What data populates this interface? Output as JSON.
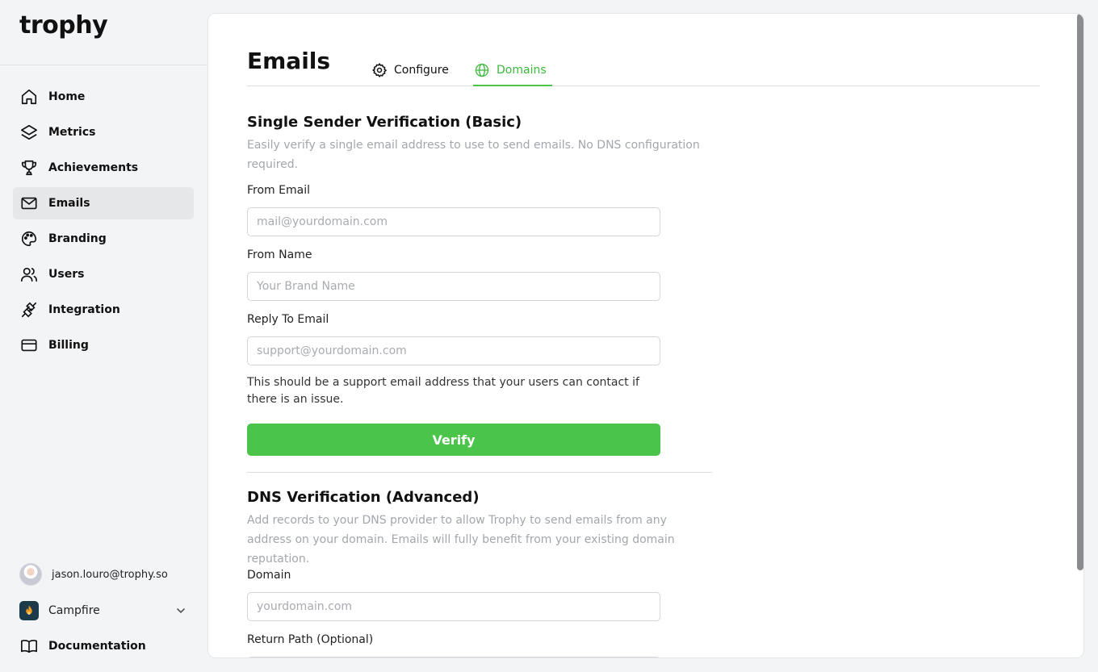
{
  "sidebar": {
    "logo": "trophy",
    "items": [
      {
        "label": "Home",
        "icon": "home-icon",
        "active": false
      },
      {
        "label": "Metrics",
        "icon": "layers-icon",
        "active": false
      },
      {
        "label": "Achievements",
        "icon": "trophy-icon",
        "active": false
      },
      {
        "label": "Emails",
        "icon": "mail-icon",
        "active": true
      },
      {
        "label": "Branding",
        "icon": "palette-icon",
        "active": false
      },
      {
        "label": "Users",
        "icon": "users-icon",
        "active": false
      },
      {
        "label": "Integration",
        "icon": "plug-icon",
        "active": false
      },
      {
        "label": "Billing",
        "icon": "credit-card-icon",
        "active": false
      }
    ],
    "user_email": "jason.louro@trophy.so",
    "org_name": "Campfire",
    "docs_label": "Documentation"
  },
  "main": {
    "title": "Emails",
    "tabs": [
      {
        "label": "Configure",
        "icon": "gear-icon",
        "active": false
      },
      {
        "label": "Domains",
        "icon": "globe-icon",
        "active": true
      }
    ],
    "single_sender": {
      "title": "Single Sender Verification (Basic)",
      "description": "Easily verify a single email address to use to send emails. No DNS configuration required.",
      "from_email": {
        "label": "From Email",
        "placeholder": "mail@yourdomain.com",
        "value": ""
      },
      "from_name": {
        "label": "From Name",
        "placeholder": "Your Brand Name",
        "value": ""
      },
      "reply_to": {
        "label": "Reply To Email",
        "placeholder": "support@yourdomain.com",
        "value": ""
      },
      "reply_hint": "This should be a support email address that your users can contact if there is an issue.",
      "verify_label": "Verify"
    },
    "dns": {
      "title": "DNS Verification (Advanced)",
      "description": "Add records to your DNS provider to allow Trophy to send emails from any address on your domain. Emails will fully benefit from your existing domain reputation.",
      "domain": {
        "label": "Domain",
        "placeholder": "yourdomain.com",
        "value": ""
      },
      "return_path": {
        "label": "Return Path (Optional)",
        "placeholder": "",
        "value": ""
      }
    }
  },
  "colors": {
    "accent_green": "#4bc44a",
    "tab_active_text": "#3cb93c",
    "muted_text": "#a3a7ad",
    "sidebar_bg": "#f3f4f6",
    "active_nav_bg": "#e6e7e9"
  }
}
